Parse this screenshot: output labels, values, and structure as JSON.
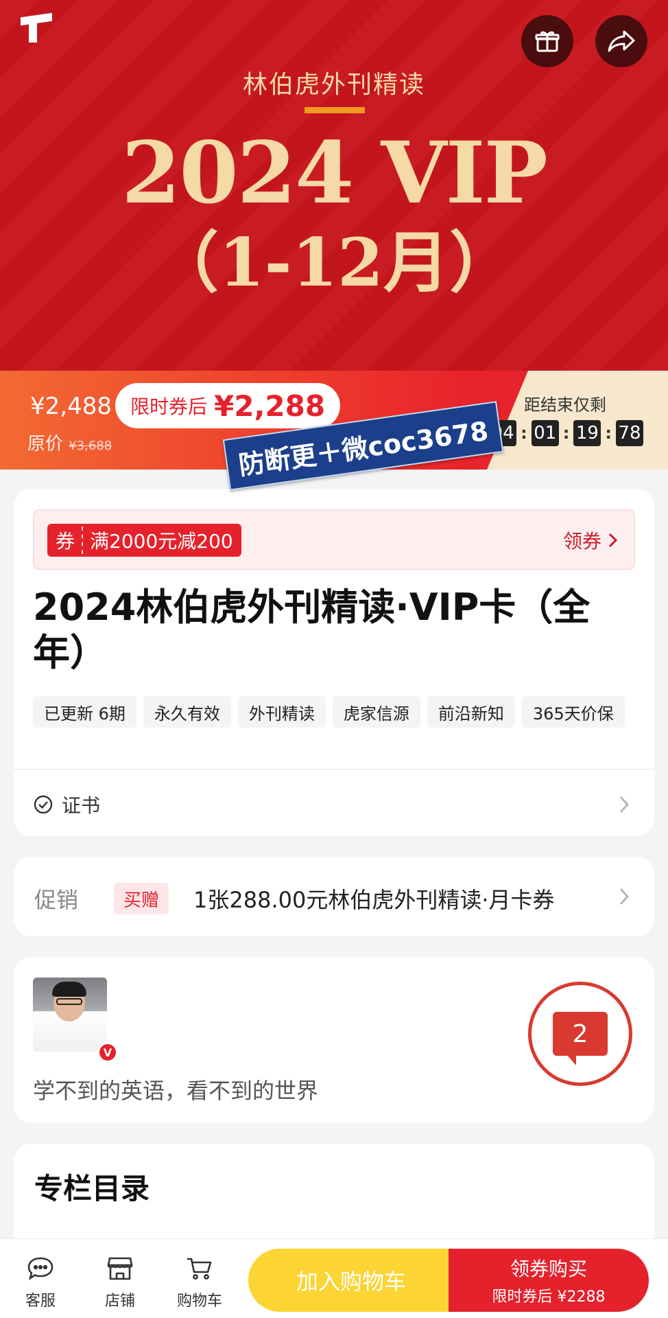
{
  "hero": {
    "logo_text": "TIGER TIMES",
    "subtitle": "林伯虎外刊精读",
    "title": "2024 VIP",
    "period": "（1-12月）"
  },
  "price": {
    "current": "¥2,488",
    "original_label": "原价",
    "original": "¥3,688",
    "coupon_label": "限时券后",
    "coupon_price": "¥2,288",
    "countdown_label": "距结束仅剩",
    "countdown": [
      "04",
      "01",
      "19",
      "78"
    ]
  },
  "watermark": "防断更＋微coc3678",
  "coupon": {
    "tag": "券",
    "text": "满2000元减200",
    "action": "领券"
  },
  "product": {
    "title": "2024林伯虎外刊精读·VIP卡（全年）",
    "tags": [
      "已更新 6期",
      "永久有效",
      "外刊精读",
      "虎家信源",
      "前沿新知",
      "365天价保"
    ],
    "cert_label": "证书"
  },
  "promo": {
    "label": "促销",
    "badge": "买赠",
    "text": "1张288.00元林伯虎外刊精读·月卡券"
  },
  "author": {
    "slogan": "学不到的英语，看不到的世界",
    "badge": "V"
  },
  "floating": {
    "count": "2"
  },
  "toc": {
    "title": "专栏目录"
  },
  "bottom_bar": {
    "service": "客服",
    "shop": "店铺",
    "cart": "购物车",
    "add_to_cart": "加入购物车",
    "buy_line1": "领券购买",
    "buy_line2": "限时券后 ¥2288"
  },
  "colors": {
    "brand_red": "#e5222c",
    "hero_red": "#c8171d",
    "gold": "#f5d9a6",
    "cart_yellow": "#fcd434"
  }
}
